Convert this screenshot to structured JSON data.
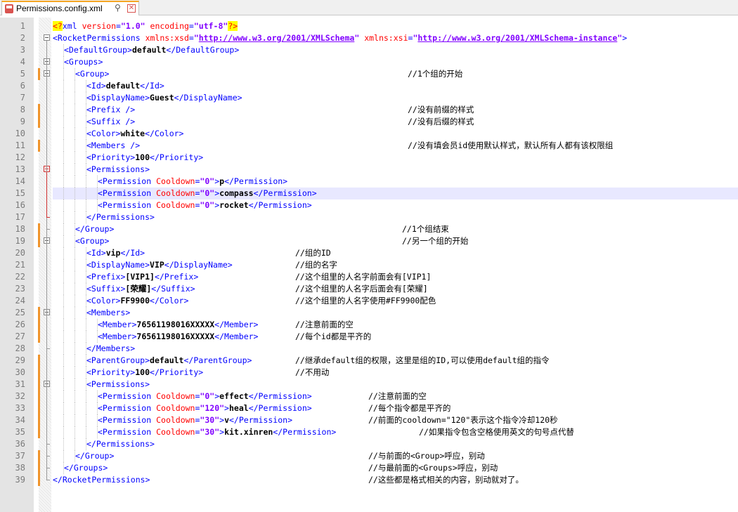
{
  "tab": {
    "title": "Permissions.config.xml",
    "icon": "xml-file-icon",
    "pin_glyph": "⚲",
    "close_glyph": "✕"
  },
  "colors": {
    "tag": "#0000ff",
    "attribute": "#ff0000",
    "value": "#8000ff",
    "change_marker": "#f0942b",
    "current_line": "#e8e8ff"
  },
  "lines": [
    {
      "n": "1",
      "ind": 0,
      "parts": [
        [
          "pi",
          "<?"
        ],
        [
          "t",
          "xml "
        ],
        [
          "a",
          "version"
        ],
        [
          "t",
          "="
        ],
        [
          "v",
          "\"1.0\""
        ],
        [
          "t",
          " "
        ],
        [
          "a",
          "encoding"
        ],
        [
          "t",
          "="
        ],
        [
          "v",
          "\"utf-8\""
        ],
        [
          "pi",
          "?>"
        ]
      ]
    },
    {
      "n": "2",
      "ind": 0,
      "parts": [
        [
          "t",
          "<RocketPermissions "
        ],
        [
          "a",
          "xmlns:xsd"
        ],
        [
          "t",
          "="
        ],
        [
          "v",
          "\""
        ],
        [
          "u",
          "http://www.w3.org/2001/XMLSchema"
        ],
        [
          "v",
          "\""
        ],
        [
          "t",
          " "
        ],
        [
          "a",
          "xmlns:xsi"
        ],
        [
          "t",
          "="
        ],
        [
          "v",
          "\""
        ],
        [
          "u",
          "http://www.w3.org/2001/XMLSchema-instance"
        ],
        [
          "v",
          "\""
        ],
        [
          "t",
          ">"
        ]
      ]
    },
    {
      "n": "3",
      "ind": 1,
      "parts": [
        [
          "t",
          "<DefaultGroup>"
        ],
        [
          "x",
          "default"
        ],
        [
          "t",
          "</DefaultGroup>"
        ]
      ]
    },
    {
      "n": "4",
      "ind": 1,
      "parts": [
        [
          "t",
          "<Groups>"
        ]
      ]
    },
    {
      "n": "5",
      "ind": 2,
      "parts": [
        [
          "t",
          "<Group>"
        ]
      ],
      "comment": "//1个组的开始"
    },
    {
      "n": "6",
      "ind": 3,
      "parts": [
        [
          "t",
          "<Id>"
        ],
        [
          "x",
          "default"
        ],
        [
          "t",
          "</Id>"
        ]
      ]
    },
    {
      "n": "7",
      "ind": 3,
      "parts": [
        [
          "t",
          "<DisplayName>"
        ],
        [
          "x",
          "Guest"
        ],
        [
          "t",
          "</DisplayName>"
        ]
      ]
    },
    {
      "n": "8",
      "ind": 3,
      "parts": [
        [
          "t",
          "<Prefix />"
        ]
      ],
      "comment": "//没有前缀的样式"
    },
    {
      "n": "9",
      "ind": 3,
      "parts": [
        [
          "t",
          "<Suffix />"
        ]
      ],
      "comment": "//没有后缀的样式"
    },
    {
      "n": "10",
      "ind": 3,
      "parts": [
        [
          "t",
          "<Color>"
        ],
        [
          "x",
          "white"
        ],
        [
          "t",
          "</Color>"
        ]
      ]
    },
    {
      "n": "11",
      "ind": 3,
      "parts": [
        [
          "t",
          "<Members />"
        ]
      ],
      "comment": "//没有填会员id使用默认样式，默认所有人都有该权限组"
    },
    {
      "n": "12",
      "ind": 3,
      "parts": [
        [
          "t",
          "<Priority>"
        ],
        [
          "x",
          "100"
        ],
        [
          "t",
          "</Priority>"
        ]
      ]
    },
    {
      "n": "13",
      "ind": 3,
      "parts": [
        [
          "t",
          "<Permissions>"
        ]
      ]
    },
    {
      "n": "14",
      "ind": 4,
      "parts": [
        [
          "t",
          "<Permission "
        ],
        [
          "a",
          "Cooldown"
        ],
        [
          "t",
          "="
        ],
        [
          "v",
          "\"0\""
        ],
        [
          "t",
          ">"
        ],
        [
          "x",
          "p"
        ],
        [
          "t",
          "</Permission>"
        ]
      ]
    },
    {
      "n": "15",
      "ind": 4,
      "parts": [
        [
          "t",
          "<Permission "
        ],
        [
          "a",
          "Cooldown"
        ],
        [
          "t",
          "="
        ],
        [
          "v",
          "\"0\""
        ],
        [
          "t",
          ">"
        ],
        [
          "x",
          "compass"
        ],
        [
          "t",
          "</Permission>"
        ]
      ]
    },
    {
      "n": "16",
      "ind": 4,
      "parts": [
        [
          "t",
          "<Permission "
        ],
        [
          "a",
          "Cooldown"
        ],
        [
          "t",
          "="
        ],
        [
          "v",
          "\"0\""
        ],
        [
          "t",
          ">"
        ],
        [
          "x",
          "rocket"
        ],
        [
          "t",
          "</Permission>"
        ]
      ]
    },
    {
      "n": "17",
      "ind": 3,
      "parts": [
        [
          "t",
          "</Permissions>"
        ]
      ]
    },
    {
      "n": "18",
      "ind": 2,
      "parts": [
        [
          "t",
          "</Group>"
        ]
      ],
      "comment": "//1个组结束"
    },
    {
      "n": "19",
      "ind": 2,
      "parts": [
        [
          "t",
          "<Group>"
        ]
      ],
      "comment": "//另一个组的开始"
    },
    {
      "n": "20",
      "ind": 3,
      "parts": [
        [
          "t",
          "<Id>"
        ],
        [
          "x",
          "vip"
        ],
        [
          "t",
          "</Id>"
        ]
      ],
      "comment": "//组的ID"
    },
    {
      "n": "21",
      "ind": 3,
      "parts": [
        [
          "t",
          "<DisplayName>"
        ],
        [
          "x",
          "VIP"
        ],
        [
          "t",
          "</DisplayName>"
        ]
      ],
      "comment": "//组的名字"
    },
    {
      "n": "22",
      "ind": 3,
      "parts": [
        [
          "t",
          "<Prefix>"
        ],
        [
          "x",
          "[VIP1]"
        ],
        [
          "t",
          "</Prefix>"
        ]
      ],
      "comment": "//这个组里的人名字前面会有[VIP1]"
    },
    {
      "n": "23",
      "ind": 3,
      "parts": [
        [
          "t",
          "<Suffix>"
        ],
        [
          "x",
          "[荣耀]"
        ],
        [
          "t",
          "</Suffix>"
        ]
      ],
      "comment": "//这个组里的人名字后面会有[荣耀]"
    },
    {
      "n": "24",
      "ind": 3,
      "parts": [
        [
          "t",
          "<Color>"
        ],
        [
          "x",
          "FF9900"
        ],
        [
          "t",
          "</Color>"
        ]
      ],
      "comment": "//这个组里的人名字使用#FF9900配色"
    },
    {
      "n": "25",
      "ind": 3,
      "parts": [
        [
          "t",
          "<Members>"
        ]
      ]
    },
    {
      "n": "26",
      "ind": 4,
      "parts": [
        [
          "t",
          "<Member>"
        ],
        [
          "x",
          "76561198016XXXXX"
        ],
        [
          "t",
          "</Member>"
        ]
      ],
      "comment": "//注意前面的空"
    },
    {
      "n": "27",
      "ind": 4,
      "parts": [
        [
          "t",
          "<Member>"
        ],
        [
          "x",
          "76561198016XXXXX"
        ],
        [
          "t",
          "</Member>"
        ]
      ],
      "comment": "//每个id都是平齐的"
    },
    {
      "n": "28",
      "ind": 3,
      "parts": [
        [
          "t",
          "</Members>"
        ]
      ]
    },
    {
      "n": "29",
      "ind": 3,
      "parts": [
        [
          "t",
          "<ParentGroup>"
        ],
        [
          "x",
          "default"
        ],
        [
          "t",
          "</ParentGroup>"
        ]
      ],
      "comment": "//继承default组的权限，这里是组的ID,可以使用default组的指令"
    },
    {
      "n": "30",
      "ind": 3,
      "parts": [
        [
          "t",
          "<Priority>"
        ],
        [
          "x",
          "100"
        ],
        [
          "t",
          "</Priority>"
        ]
      ],
      "comment": "//不用动"
    },
    {
      "n": "31",
      "ind": 3,
      "parts": [
        [
          "t",
          "<Permissions>"
        ]
      ]
    },
    {
      "n": "32",
      "ind": 4,
      "parts": [
        [
          "t",
          "<Permission "
        ],
        [
          "a",
          "Cooldown"
        ],
        [
          "t",
          "="
        ],
        [
          "v",
          "\"0\""
        ],
        [
          "t",
          ">"
        ],
        [
          "x",
          "effect"
        ],
        [
          "t",
          "</Permission>"
        ]
      ],
      "comment": "//注意前面的空"
    },
    {
      "n": "33",
      "ind": 4,
      "parts": [
        [
          "t",
          "<Permission "
        ],
        [
          "a",
          "Cooldown"
        ],
        [
          "t",
          "="
        ],
        [
          "v",
          "\"120\""
        ],
        [
          "t",
          ">"
        ],
        [
          "x",
          "heal"
        ],
        [
          "t",
          "</Permission>"
        ]
      ],
      "comment": "//每个指令都是平齐的"
    },
    {
      "n": "34",
      "ind": 4,
      "parts": [
        [
          "t",
          "<Permission "
        ],
        [
          "a",
          "Cooldown"
        ],
        [
          "t",
          "="
        ],
        [
          "v",
          "\"30\""
        ],
        [
          "t",
          ">"
        ],
        [
          "x",
          "v"
        ],
        [
          "t",
          "</Permission>"
        ]
      ],
      "comment": "//前面的cooldown=\"120\"表示这个指令冷却120秒"
    },
    {
      "n": "35",
      "ind": 4,
      "parts": [
        [
          "t",
          "<Permission "
        ],
        [
          "a",
          "Cooldown"
        ],
        [
          "t",
          "="
        ],
        [
          "v",
          "\"30\""
        ],
        [
          "t",
          ">"
        ],
        [
          "x",
          "kit.xinren"
        ],
        [
          "t",
          "</Permission>"
        ]
      ],
      "comment": "//如果指令包含空格使用英文的句号点代替"
    },
    {
      "n": "36",
      "ind": 3,
      "parts": [
        [
          "t",
          "</Permissions>"
        ]
      ]
    },
    {
      "n": "37",
      "ind": 2,
      "parts": [
        [
          "t",
          "</Group>"
        ]
      ],
      "comment": "//与前面的<Group>呼应，别动"
    },
    {
      "n": "38",
      "ind": 1,
      "parts": [
        [
          "t",
          "</Groups>"
        ]
      ],
      "comment": "//与最前面的<Groups>呼应，别动"
    },
    {
      "n": "39",
      "ind": 0,
      "parts": [
        [
          "t",
          "</RocketPermissions>"
        ]
      ],
      "comment": "//这些都是格式相关的内容，别动就对了。"
    }
  ]
}
